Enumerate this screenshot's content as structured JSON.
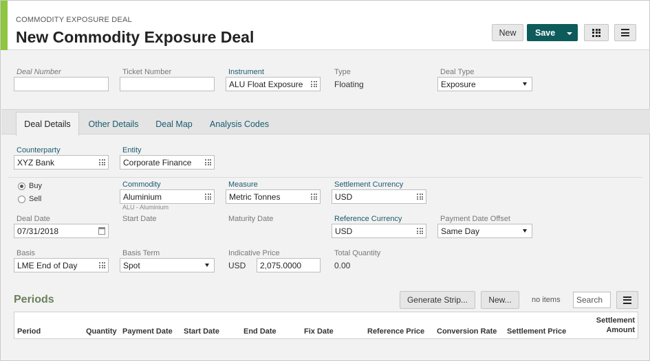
{
  "header": {
    "breadcrumb": "COMMODITY EXPOSURE DEAL",
    "title": "New Commodity Exposure Deal",
    "new_label": "New",
    "save_label": "Save"
  },
  "top_fields": {
    "deal_number_label": "Deal Number",
    "deal_number_value": "",
    "ticket_number_label": "Ticket Number",
    "ticket_number_value": "",
    "instrument_label": "Instrument",
    "instrument_value": "ALU Float Exposure",
    "type_label": "Type",
    "type_value": "Floating",
    "deal_type_label": "Deal Type",
    "deal_type_value": "Exposure"
  },
  "tabs": [
    {
      "label": "Deal Details",
      "active": true
    },
    {
      "label": "Other Details",
      "active": false
    },
    {
      "label": "Deal Map",
      "active": false
    },
    {
      "label": "Analysis Codes",
      "active": false
    }
  ],
  "details": {
    "counterparty_label": "Counterparty",
    "counterparty_value": "XYZ Bank",
    "entity_label": "Entity",
    "entity_value": "Corporate Finance",
    "buy_label": "Buy",
    "sell_label": "Sell",
    "direction_selected": "Buy",
    "commodity_label": "Commodity",
    "commodity_value": "Aluminium",
    "commodity_note": "ALU - Aluminium",
    "measure_label": "Measure",
    "measure_value": "Metric Tonnes",
    "settlement_currency_label": "Settlement Currency",
    "settlement_currency_value": "USD",
    "deal_date_label": "Deal Date",
    "deal_date_value": "07/31/2018",
    "start_date_label": "Start Date",
    "maturity_date_label": "Maturity Date",
    "reference_currency_label": "Reference Currency",
    "reference_currency_value": "USD",
    "payment_date_offset_label": "Payment Date Offset",
    "payment_date_offset_value": "Same Day",
    "basis_label": "Basis",
    "basis_value": "LME End of Day",
    "basis_term_label": "Basis Term",
    "basis_term_value": "Spot",
    "indicative_price_label": "Indicative Price",
    "indicative_price_currency": "USD",
    "indicative_price_value": "2,075.0000",
    "total_quantity_label": "Total Quantity",
    "total_quantity_value": "0.00"
  },
  "periods": {
    "title": "Periods",
    "generate_strip_label": "Generate Strip...",
    "new_label": "New...",
    "count_text": "no items",
    "search_placeholder": "Search",
    "columns": [
      "Period",
      "Quantity",
      "Payment Date",
      "Start Date",
      "End Date",
      "Fix Date",
      "Reference Price",
      "Conversion Rate",
      "Settlement Price",
      "Settlement",
      "Amount"
    ]
  },
  "colors": {
    "accent_green": "#8dc63f",
    "save_teal": "#0d5b5b",
    "label_teal": "#1a5a6e"
  }
}
